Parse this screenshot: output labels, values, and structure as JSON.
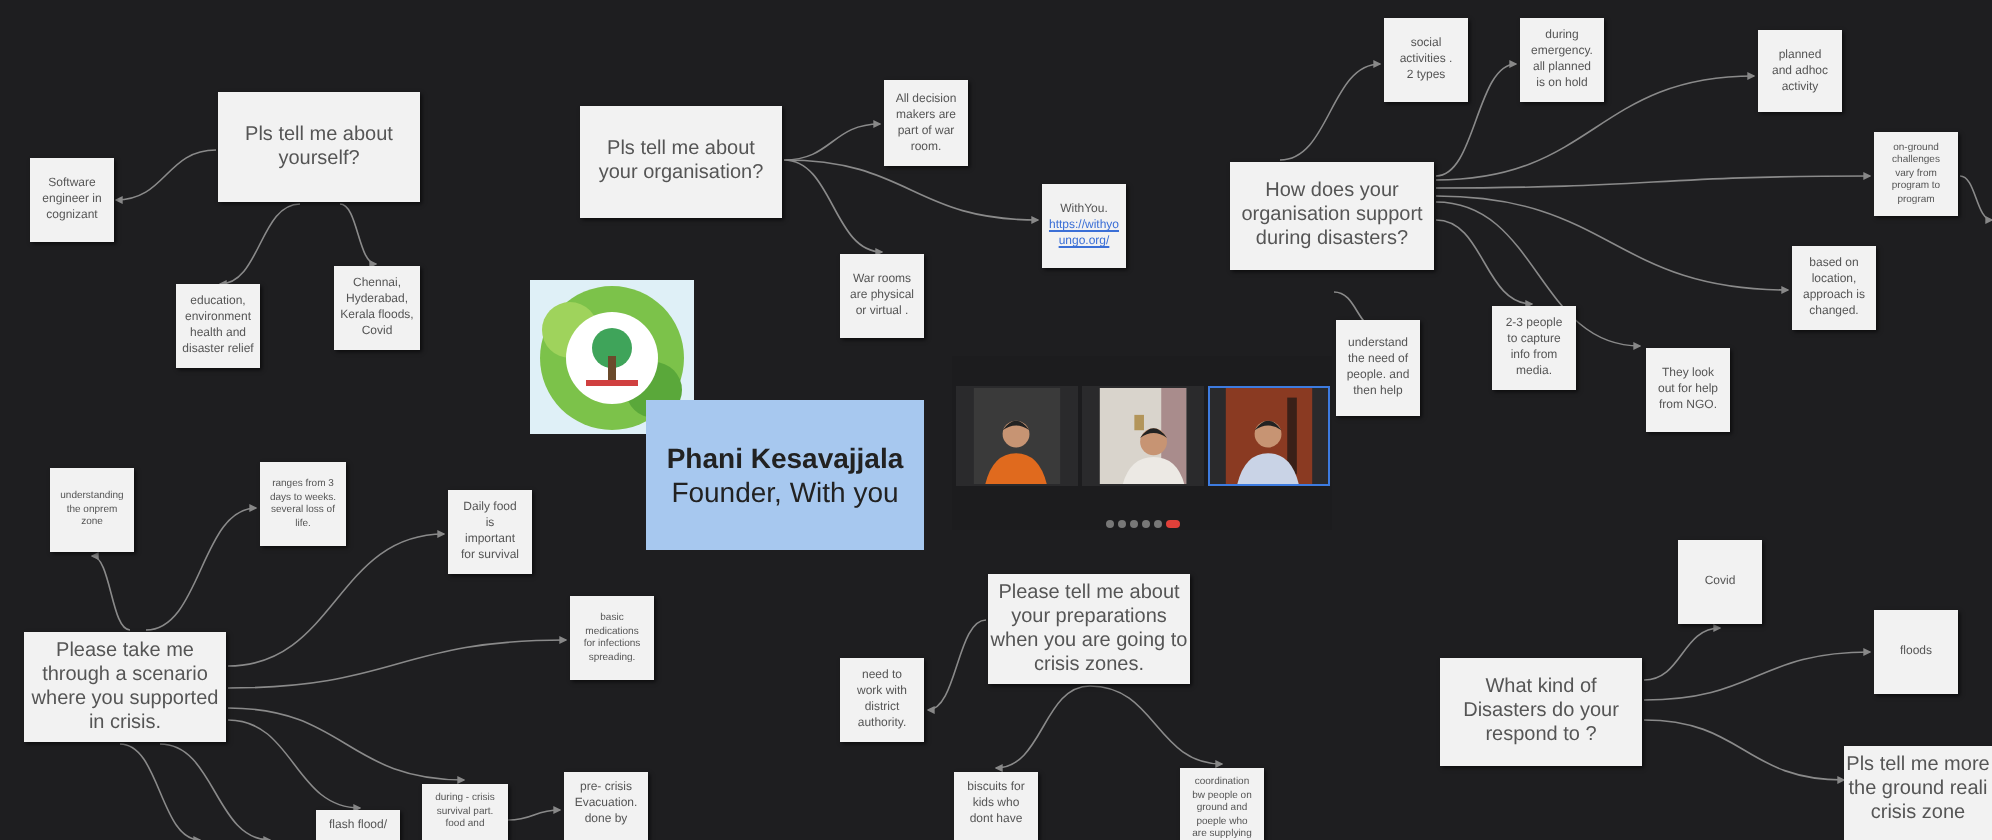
{
  "notes": [
    {
      "kind": "question",
      "lines": [
        "Pls tell me about",
        "yourself?"
      ]
    },
    {
      "kind": "answer",
      "lines": [
        "Software",
        "engineer in",
        "cognizant"
      ]
    },
    {
      "kind": "answer",
      "lines": [
        "education,",
        "environment",
        "health and",
        "disaster relief"
      ]
    },
    {
      "kind": "answer",
      "lines": [
        "Chennai,",
        "Hyderabad,",
        "Kerala floods,",
        "Covid"
      ]
    },
    {
      "kind": "question",
      "lines": [
        "Pls tell me about",
        "your organisation?"
      ]
    },
    {
      "kind": "answer",
      "lines": [
        "All decision",
        "makers are",
        "part of war",
        "room."
      ]
    },
    {
      "kind": "link_note",
      "text": "WithYou.",
      "link": "https://withyoungo.org/"
    },
    {
      "kind": "answer",
      "lines": [
        "War rooms",
        "are physical",
        "or virtual ."
      ]
    },
    {
      "kind": "answer",
      "lines": [
        "social",
        "activities .",
        "2 types"
      ]
    },
    {
      "kind": "answer",
      "lines": [
        "during",
        "emergency.",
        "all planned",
        "is on hold"
      ]
    },
    {
      "kind": "answer",
      "lines": [
        "planned",
        "and adhoc",
        "activity"
      ]
    },
    {
      "kind": "question",
      "lines": [
        "How does your",
        "organisation support",
        "during disasters?"
      ]
    },
    {
      "kind": "tiny",
      "lines": [
        "on-ground",
        "challenges",
        "vary from",
        "program to",
        "program"
      ]
    },
    {
      "kind": "answer",
      "lines": [
        "based on",
        "location,",
        "approach is",
        "changed."
      ]
    },
    {
      "kind": "answer",
      "lines": [
        "understand",
        "the need of",
        "people. and",
        "then help"
      ]
    },
    {
      "kind": "answer",
      "lines": [
        "2-3 people",
        "to capture",
        "info from",
        "media."
      ]
    },
    {
      "kind": "answer",
      "lines": [
        "They look",
        "out for help",
        "from NGO."
      ]
    },
    {
      "kind": "tiny",
      "lines": [
        "understanding",
        "the onprem",
        "zone"
      ]
    },
    {
      "kind": "tiny",
      "lines": [
        "ranges from 3",
        "days to weeks.",
        "several loss of",
        "life."
      ]
    },
    {
      "kind": "answer",
      "lines": [
        "Daily food",
        "is",
        "important",
        "for survival"
      ]
    },
    {
      "kind": "question",
      "lines": [
        "Please take me",
        "through a scenario",
        "where you supported",
        "in crisis."
      ]
    },
    {
      "kind": "tiny",
      "lines": [
        "basic",
        "medications",
        "for infections",
        "spreading."
      ]
    },
    {
      "kind": "question",
      "lines": [
        "Please tell me about",
        "your preparations",
        "when you are going to",
        "crisis zones."
      ]
    },
    {
      "kind": "answer",
      "lines": [
        "need to",
        "work with",
        "district",
        "authority."
      ]
    },
    {
      "kind": "question",
      "lines": [
        "What kind of",
        "Disasters do your",
        "respond to ?"
      ]
    },
    {
      "kind": "answer",
      "lines": [
        "Covid"
      ]
    },
    {
      "kind": "answer",
      "lines": [
        "floods"
      ]
    },
    {
      "kind": "question",
      "lines": [
        "Pls tell me more",
        "the ground reali",
        "crisis zone"
      ]
    },
    {
      "kind": "answer",
      "lines": [
        "flash flood/"
      ]
    },
    {
      "kind": "tiny",
      "lines": [
        "during - crisis",
        "survival part.",
        "food and"
      ]
    },
    {
      "kind": "answer",
      "lines": [
        "pre- crisis",
        "Evacuation.",
        "done by"
      ]
    },
    {
      "kind": "answer",
      "lines": [
        "biscuits for",
        "kids who",
        "dont have"
      ]
    },
    {
      "kind": "tiny",
      "lines": [
        "coordination",
        "bw people on",
        "ground and",
        "poeple who",
        "are supplying"
      ]
    }
  ],
  "profile_card": {
    "name": "Phani Kesavajjala",
    "role": "Founder, With you"
  },
  "video_call": {
    "tiles": [
      {
        "selected": false
      },
      {
        "selected": false
      },
      {
        "selected": true
      }
    ]
  }
}
